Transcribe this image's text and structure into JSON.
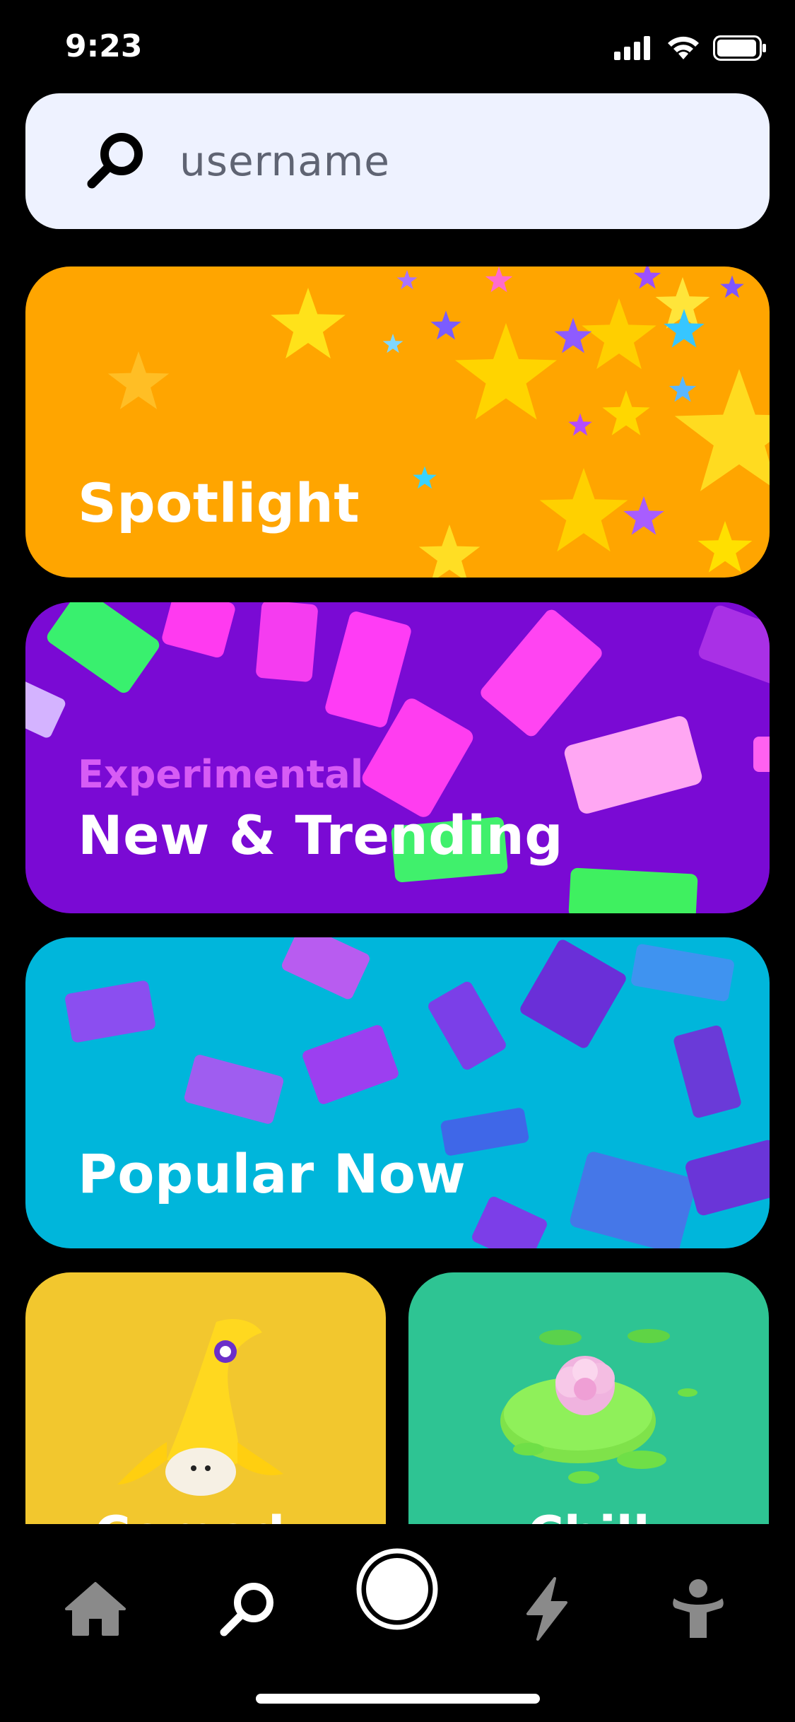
{
  "status_bar": {
    "time": "9:23"
  },
  "search": {
    "placeholder": "username",
    "icon": "search-icon"
  },
  "cards": {
    "spotlight": {
      "label": "Spotlight",
      "color": "#ffa500"
    },
    "new_trending": {
      "eyebrow": "Experimental",
      "label": "New & Trending",
      "color": "#7a0ad4",
      "eyebrow_color": "#d75cf5"
    },
    "popular_now": {
      "label": "Popular Now",
      "color": "#00b6db"
    }
  },
  "small_cards": {
    "left": {
      "label": "Comedy",
      "color": "#f2c72e"
    },
    "right": {
      "label": "Chill",
      "color": "#2ec493"
    }
  },
  "bottom_nav": {
    "items": [
      {
        "name": "home",
        "icon": "home-icon",
        "active": false
      },
      {
        "name": "search",
        "icon": "search-icon",
        "active": true
      },
      {
        "name": "camera",
        "icon": "camera-icon",
        "active": false
      },
      {
        "name": "activity",
        "icon": "lightning-icon",
        "active": false
      },
      {
        "name": "profile",
        "icon": "person-icon",
        "active": false
      }
    ]
  }
}
